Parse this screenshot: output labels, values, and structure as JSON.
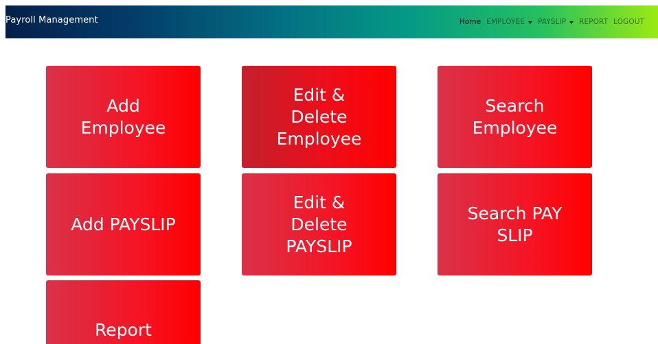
{
  "navbar": {
    "brand": "Payroll Management",
    "links": [
      {
        "label": "Home",
        "active": true,
        "dropdown": false
      },
      {
        "label": "EMPLOYEE",
        "active": false,
        "dropdown": true
      },
      {
        "label": "PAYSLIP",
        "active": false,
        "dropdown": true
      },
      {
        "label": "REPORT",
        "active": false,
        "dropdown": false
      },
      {
        "label": "LOGOUT",
        "active": false,
        "dropdown": false
      }
    ]
  },
  "tiles": {
    "add_employee": "Add Employee",
    "edit_delete_employee": "Edit & Delete Employee",
    "search_employee": "Search Employee",
    "add_payslip": "Add PAYSLIP",
    "edit_delete_payslip": "Edit & Delete PAYSLIP",
    "search_payslip": "Search PAY SLIP",
    "report": "Report"
  },
  "colors": {
    "tile_gradient_start": "#d93249",
    "tile_gradient_end": "#ff0000",
    "navbar_gradient_start": "#04204a",
    "navbar_gradient_end": "#9bea12"
  }
}
